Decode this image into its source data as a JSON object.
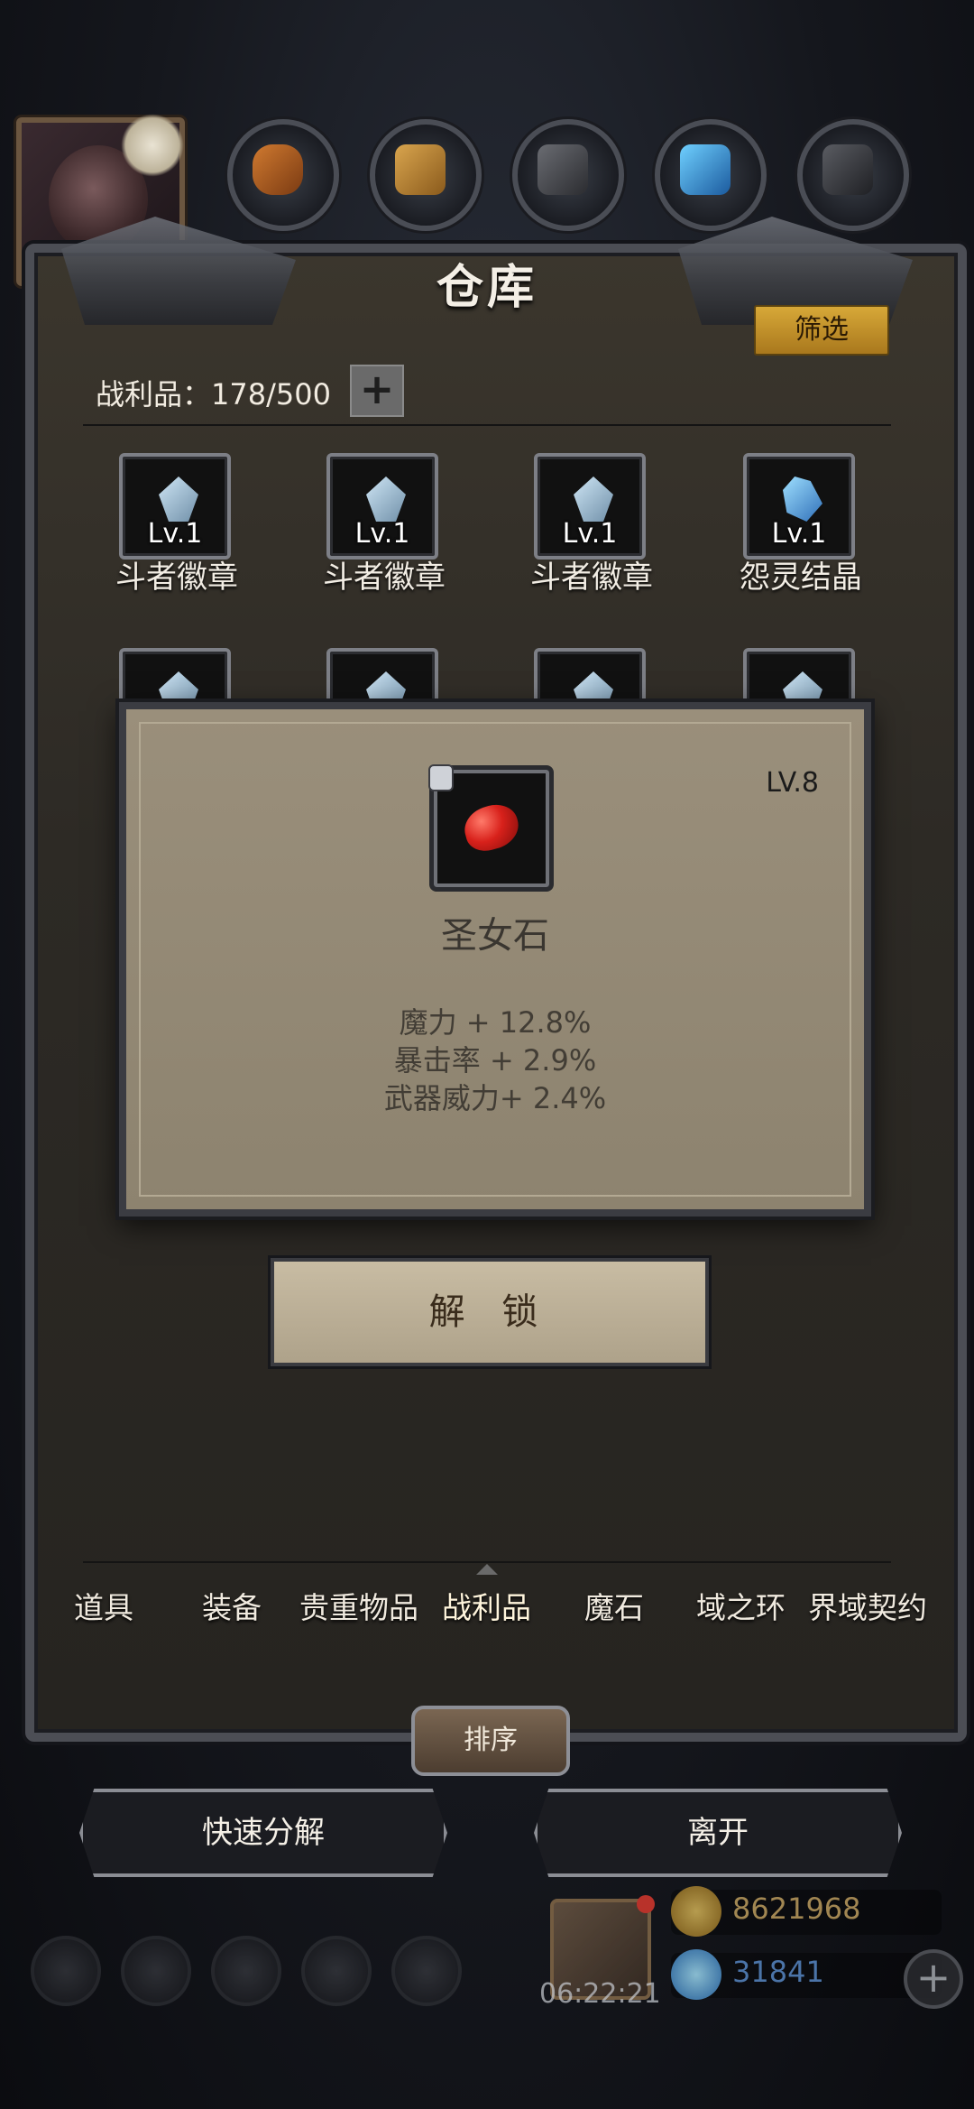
{
  "colors": {
    "accent_gold": "#d7a838",
    "panel_bg": "#2d2a25",
    "popup_bg": "#9a8f7b",
    "stone_red": "#d8211b"
  },
  "top_resources": [
    "wood-log-icon",
    "plank-icon",
    "iron-ingot-icon",
    "crystal-icon",
    "stone-block-icon"
  ],
  "header": {
    "title": "仓库",
    "filter_label": "筛选"
  },
  "inventory": {
    "label": "战利品：178/500",
    "add_icon": "plus-icon"
  },
  "grid": [
    {
      "level": "Lv.1",
      "name": "斗者徽章",
      "icon": "badge-icon"
    },
    {
      "level": "Lv.1",
      "name": "斗者徽章",
      "icon": "badge-icon"
    },
    {
      "level": "Lv.1",
      "name": "斗者徽章",
      "icon": "badge-icon"
    },
    {
      "level": "Lv.1",
      "name": "怨灵结晶",
      "icon": "crystal-icon"
    }
  ],
  "detail": {
    "level": "LV.8",
    "name": "圣女石",
    "icon": "red-stone-icon",
    "stats": [
      "魔力 + 12.8%",
      "暴击率 + 2.9%",
      "武器威力+ 2.4%"
    ],
    "unlock_label": "解 锁"
  },
  "tabs": [
    "道具",
    "装备",
    "贵重物品",
    "战利品",
    "魔石",
    "域之环",
    "界域契约"
  ],
  "active_tab": "战利品",
  "sort_label": "排序",
  "quick_decompose_label": "快速分解",
  "leave_label": "离开",
  "hud": {
    "timer": "06:22:21",
    "gold": "8621968",
    "gems": "31841"
  }
}
